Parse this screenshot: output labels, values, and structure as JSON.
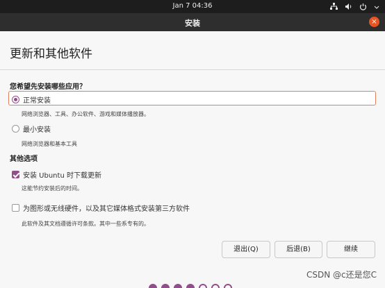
{
  "topbar": {
    "clock": "Jan 7  04:36"
  },
  "window": {
    "title": "安装",
    "close_glyph": "×"
  },
  "page": {
    "title": "更新和其他软件"
  },
  "install_section": {
    "label": "您希望先安装哪些应用？",
    "normal": {
      "label": "正常安装",
      "desc": "网络浏览器、工具、办公软件、游戏和媒体播放器。",
      "selected": true
    },
    "minimal": {
      "label": "最小安装",
      "desc": "网络浏览器和基本工具",
      "selected": false
    }
  },
  "other_section": {
    "label": "其他选项",
    "download_updates": {
      "label": "安装 Ubuntu 时下载更新",
      "desc": "这能节约安装后的时间。",
      "checked": true
    },
    "third_party": {
      "label": "为图形或无线硬件，以及其它媒体格式安装第三方软件",
      "desc": "此软件及其文档遵循许可条款。其中一些系专有的。",
      "checked": false
    }
  },
  "buttons": {
    "quit": "退出(Q)",
    "back": "后退(B)",
    "continue": "继续"
  },
  "progress": {
    "current_step": 4,
    "total_steps": 7
  },
  "watermark": "CSDN @c还是您C",
  "colors": {
    "accent": "#924d8b",
    "close": "#e95420",
    "focus": "#e07f5b"
  }
}
